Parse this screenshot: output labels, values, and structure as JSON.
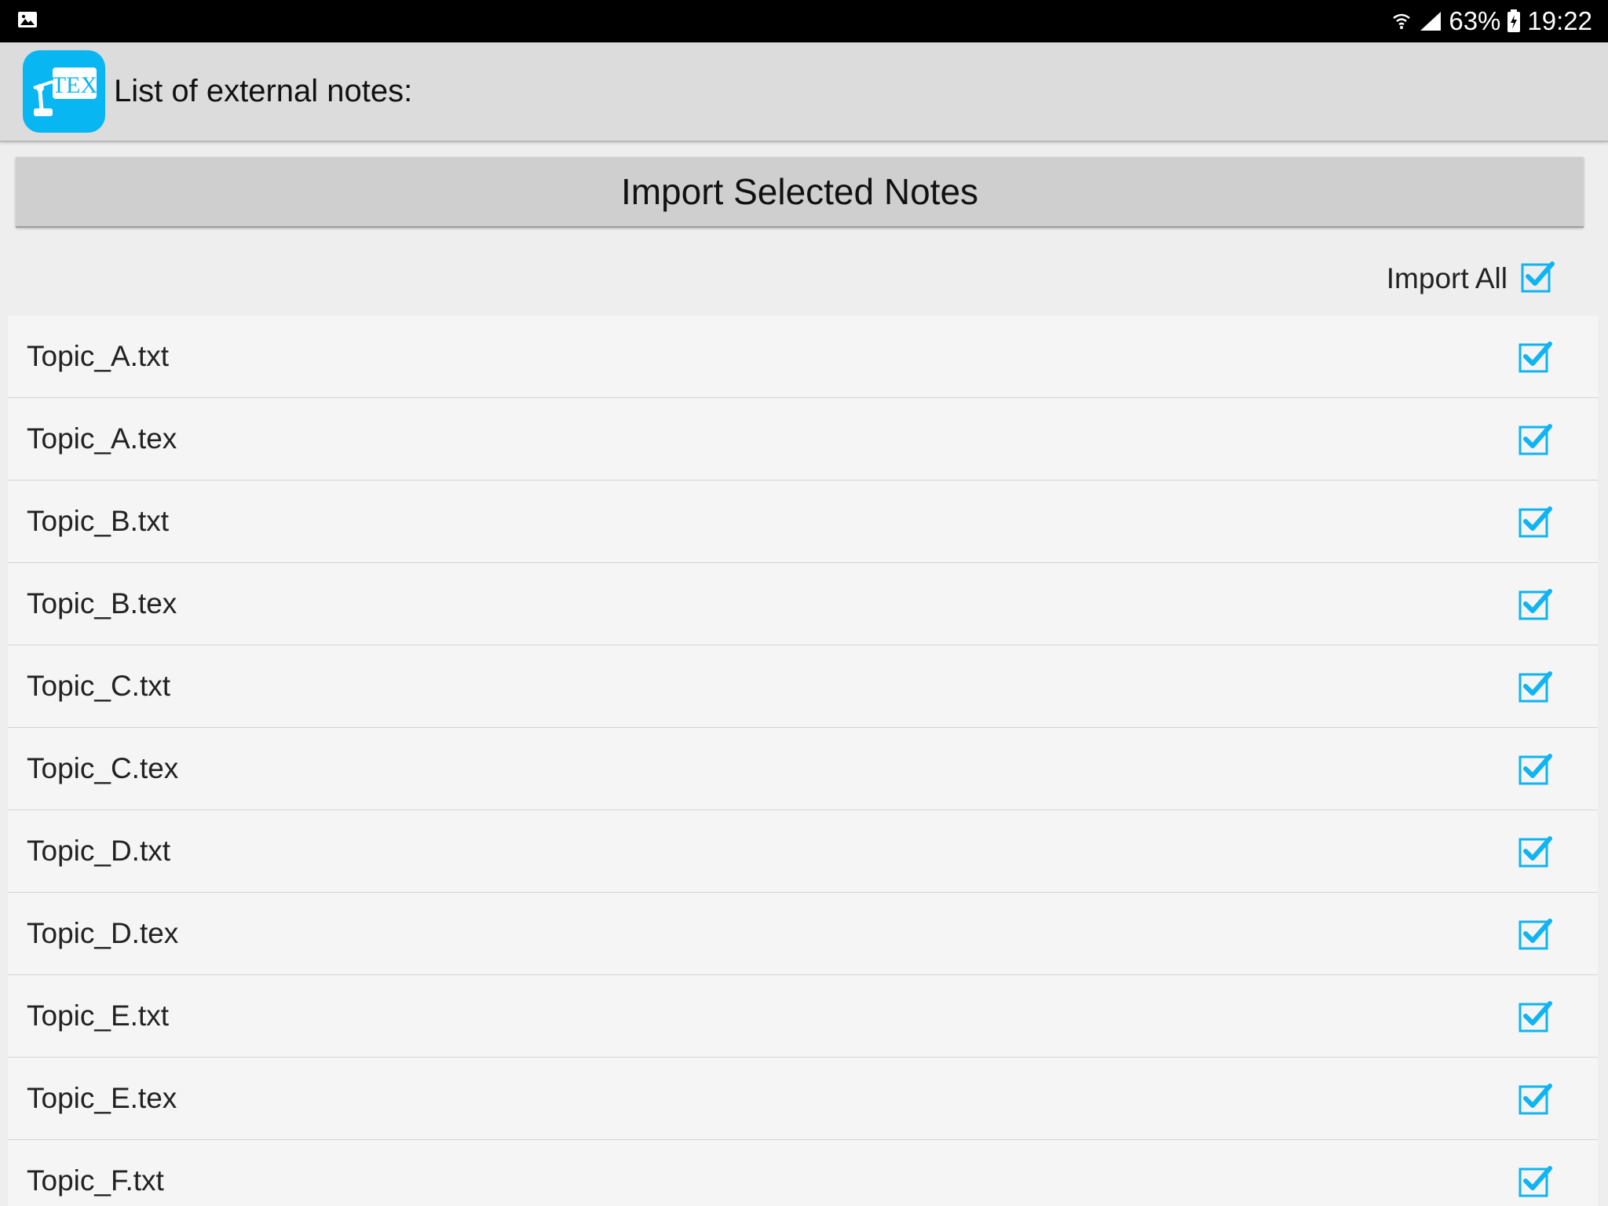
{
  "status_bar": {
    "battery": "63%",
    "time": "19:22",
    "left_icon": "image-notification-icon",
    "right_icons": [
      "wifi-icon",
      "signal-icon",
      "battery-charging-icon"
    ]
  },
  "app_bar": {
    "logo_text": "TEX",
    "title": "List of external notes:"
  },
  "import_button_label": "Import Selected Notes",
  "import_all": {
    "label": "Import All",
    "checked": true
  },
  "accent_color": "#0fb4f0",
  "notes": [
    {
      "name": "Topic_A.txt",
      "checked": true
    },
    {
      "name": "Topic_A.tex",
      "checked": true
    },
    {
      "name": "Topic_B.txt",
      "checked": true
    },
    {
      "name": "Topic_B.tex",
      "checked": true
    },
    {
      "name": "Topic_C.txt",
      "checked": true
    },
    {
      "name": "Topic_C.tex",
      "checked": true
    },
    {
      "name": "Topic_D.txt",
      "checked": true
    },
    {
      "name": "Topic_D.tex",
      "checked": true
    },
    {
      "name": "Topic_E.txt",
      "checked": true
    },
    {
      "name": "Topic_E.tex",
      "checked": true
    },
    {
      "name": "Topic_F.txt",
      "checked": true
    }
  ]
}
